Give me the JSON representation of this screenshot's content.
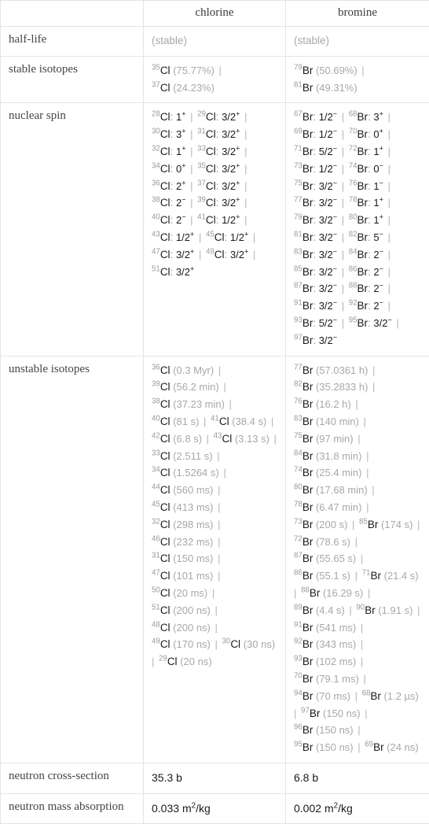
{
  "table": {
    "columns": [
      "",
      "chlorine",
      "bromine"
    ],
    "rows": [
      {
        "label": "half-life",
        "type": "dim",
        "chlorine": "(stable)",
        "bromine": "(stable)"
      },
      {
        "label": "stable isotopes",
        "type": "isotopes",
        "chlorine": [
          {
            "mass": "35",
            "el": "Cl",
            "note": "(75.77%)"
          },
          {
            "mass": "37",
            "el": "Cl",
            "note": "(24.23%)"
          }
        ],
        "bromine": [
          {
            "mass": "79",
            "el": "Br",
            "note": "(50.69%)"
          },
          {
            "mass": "81",
            "el": "Br",
            "note": "(49.31%)"
          }
        ]
      },
      {
        "label": "nuclear spin",
        "type": "spin",
        "chlorine": [
          {
            "mass": "28",
            "el": "Cl",
            "spin": "1",
            "charge": "+"
          },
          {
            "mass": "29",
            "el": "Cl",
            "spin": "3/2",
            "charge": "+"
          },
          {
            "mass": "30",
            "el": "Cl",
            "spin": "3",
            "charge": "+"
          },
          {
            "mass": "31",
            "el": "Cl",
            "spin": "3/2",
            "charge": "+"
          },
          {
            "mass": "32",
            "el": "Cl",
            "spin": "1",
            "charge": "+"
          },
          {
            "mass": "33",
            "el": "Cl",
            "spin": "3/2",
            "charge": "+"
          },
          {
            "mass": "34",
            "el": "Cl",
            "spin": "0",
            "charge": "+"
          },
          {
            "mass": "35",
            "el": "Cl",
            "spin": "3/2",
            "charge": "+"
          },
          {
            "mass": "36",
            "el": "Cl",
            "spin": "2",
            "charge": "+"
          },
          {
            "mass": "37",
            "el": "Cl",
            "spin": "3/2",
            "charge": "+"
          },
          {
            "mass": "38",
            "el": "Cl",
            "spin": "2",
            "charge": "−"
          },
          {
            "mass": "39",
            "el": "Cl",
            "spin": "3/2",
            "charge": "+"
          },
          {
            "mass": "40",
            "el": "Cl",
            "spin": "2",
            "charge": "−"
          },
          {
            "mass": "41",
            "el": "Cl",
            "spin": "1/2",
            "charge": "+"
          },
          {
            "mass": "43",
            "el": "Cl",
            "spin": "1/2",
            "charge": "+"
          },
          {
            "mass": "45",
            "el": "Cl",
            "spin": "1/2",
            "charge": "+"
          },
          {
            "mass": "47",
            "el": "Cl",
            "spin": "3/2",
            "charge": "+"
          },
          {
            "mass": "49",
            "el": "Cl",
            "spin": "3/2",
            "charge": "+"
          },
          {
            "mass": "51",
            "el": "Cl",
            "spin": "3/2",
            "charge": "+"
          }
        ],
        "bromine": [
          {
            "mass": "67",
            "el": "Br",
            "spin": "1/2",
            "charge": "−"
          },
          {
            "mass": "68",
            "el": "Br",
            "spin": "3",
            "charge": "+"
          },
          {
            "mass": "69",
            "el": "Br",
            "spin": "1/2",
            "charge": "−"
          },
          {
            "mass": "70",
            "el": "Br",
            "spin": "0",
            "charge": "+"
          },
          {
            "mass": "71",
            "el": "Br",
            "spin": "5/2",
            "charge": "−"
          },
          {
            "mass": "72",
            "el": "Br",
            "spin": "1",
            "charge": "+"
          },
          {
            "mass": "73",
            "el": "Br",
            "spin": "1/2",
            "charge": "−"
          },
          {
            "mass": "74",
            "el": "Br",
            "spin": "0",
            "charge": "−"
          },
          {
            "mass": "75",
            "el": "Br",
            "spin": "3/2",
            "charge": "−"
          },
          {
            "mass": "76",
            "el": "Br",
            "spin": "1",
            "charge": "−"
          },
          {
            "mass": "77",
            "el": "Br",
            "spin": "3/2",
            "charge": "−"
          },
          {
            "mass": "78",
            "el": "Br",
            "spin": "1",
            "charge": "+"
          },
          {
            "mass": "79",
            "el": "Br",
            "spin": "3/2",
            "charge": "−"
          },
          {
            "mass": "80",
            "el": "Br",
            "spin": "1",
            "charge": "+"
          },
          {
            "mass": "81",
            "el": "Br",
            "spin": "3/2",
            "charge": "−"
          },
          {
            "mass": "82",
            "el": "Br",
            "spin": "5",
            "charge": "−"
          },
          {
            "mass": "83",
            "el": "Br",
            "spin": "3/2",
            "charge": "−"
          },
          {
            "mass": "84",
            "el": "Br",
            "spin": "2",
            "charge": "−"
          },
          {
            "mass": "85",
            "el": "Br",
            "spin": "3/2",
            "charge": "−"
          },
          {
            "mass": "86",
            "el": "Br",
            "spin": "2",
            "charge": "−"
          },
          {
            "mass": "87",
            "el": "Br",
            "spin": "3/2",
            "charge": "−"
          },
          {
            "mass": "88",
            "el": "Br",
            "spin": "2",
            "charge": "−"
          },
          {
            "mass": "91",
            "el": "Br",
            "spin": "3/2",
            "charge": "−"
          },
          {
            "mass": "92",
            "el": "Br",
            "spin": "2",
            "charge": "−"
          },
          {
            "mass": "93",
            "el": "Br",
            "spin": "5/2",
            "charge": "−"
          },
          {
            "mass": "95",
            "el": "Br",
            "spin": "3/2",
            "charge": "−"
          },
          {
            "mass": "97",
            "el": "Br",
            "spin": "3/2",
            "charge": "−"
          }
        ]
      },
      {
        "label": "unstable isotopes",
        "type": "isotopes",
        "chlorine": [
          {
            "mass": "36",
            "el": "Cl",
            "note": "(0.3 Myr)"
          },
          {
            "mass": "39",
            "el": "Cl",
            "note": "(56.2 min)"
          },
          {
            "mass": "38",
            "el": "Cl",
            "note": "(37.23 min)"
          },
          {
            "mass": "40",
            "el": "Cl",
            "note": "(81 s)"
          },
          {
            "mass": "41",
            "el": "Cl",
            "note": "(38.4 s)"
          },
          {
            "mass": "42",
            "el": "Cl",
            "note": "(6.8 s)"
          },
          {
            "mass": "43",
            "el": "Cl",
            "note": "(3.13 s)"
          },
          {
            "mass": "33",
            "el": "Cl",
            "note": "(2.511 s)"
          },
          {
            "mass": "34",
            "el": "Cl",
            "note": "(1.5264 s)"
          },
          {
            "mass": "44",
            "el": "Cl",
            "note": "(560 ms)"
          },
          {
            "mass": "45",
            "el": "Cl",
            "note": "(413 ms)"
          },
          {
            "mass": "32",
            "el": "Cl",
            "note": "(298 ms)"
          },
          {
            "mass": "46",
            "el": "Cl",
            "note": "(232 ms)"
          },
          {
            "mass": "31",
            "el": "Cl",
            "note": "(150 ms)"
          },
          {
            "mass": "47",
            "el": "Cl",
            "note": "(101 ms)"
          },
          {
            "mass": "50",
            "el": "Cl",
            "note": "(20 ms)"
          },
          {
            "mass": "51",
            "el": "Cl",
            "note": "(200 ns)"
          },
          {
            "mass": "48",
            "el": "Cl",
            "note": "(200 ns)"
          },
          {
            "mass": "49",
            "el": "Cl",
            "note": "(170 ns)"
          },
          {
            "mass": "30",
            "el": "Cl",
            "note": "(30 ns)"
          },
          {
            "mass": "29",
            "el": "Cl",
            "note": "(20 ns)"
          }
        ],
        "bromine": [
          {
            "mass": "77",
            "el": "Br",
            "note": "(57.0361 h)"
          },
          {
            "mass": "82",
            "el": "Br",
            "note": "(35.2833 h)"
          },
          {
            "mass": "76",
            "el": "Br",
            "note": "(16.2 h)"
          },
          {
            "mass": "83",
            "el": "Br",
            "note": "(140 min)"
          },
          {
            "mass": "75",
            "el": "Br",
            "note": "(97 min)"
          },
          {
            "mass": "84",
            "el": "Br",
            "note": "(31.8 min)"
          },
          {
            "mass": "74",
            "el": "Br",
            "note": "(25.4 min)"
          },
          {
            "mass": "80",
            "el": "Br",
            "note": "(17.68 min)"
          },
          {
            "mass": "78",
            "el": "Br",
            "note": "(6.47 min)"
          },
          {
            "mass": "73",
            "el": "Br",
            "note": "(200 s)"
          },
          {
            "mass": "85",
            "el": "Br",
            "note": "(174 s)"
          },
          {
            "mass": "72",
            "el": "Br",
            "note": "(78.6 s)"
          },
          {
            "mass": "87",
            "el": "Br",
            "note": "(55.65 s)"
          },
          {
            "mass": "86",
            "el": "Br",
            "note": "(55.1 s)"
          },
          {
            "mass": "71",
            "el": "Br",
            "note": "(21.4 s)"
          },
          {
            "mass": "88",
            "el": "Br",
            "note": "(16.29 s)"
          },
          {
            "mass": "89",
            "el": "Br",
            "note": "(4.4 s)"
          },
          {
            "mass": "90",
            "el": "Br",
            "note": "(1.91 s)"
          },
          {
            "mass": "91",
            "el": "Br",
            "note": "(541 ms)"
          },
          {
            "mass": "92",
            "el": "Br",
            "note": "(343 ms)"
          },
          {
            "mass": "93",
            "el": "Br",
            "note": "(102 ms)"
          },
          {
            "mass": "70",
            "el": "Br",
            "note": "(79.1 ms)"
          },
          {
            "mass": "94",
            "el": "Br",
            "note": "(70 ms)"
          },
          {
            "mass": "68",
            "el": "Br",
            "note": "(1.2 µs)"
          },
          {
            "mass": "97",
            "el": "Br",
            "note": "(150 ns)"
          },
          {
            "mass": "96",
            "el": "Br",
            "note": "(150 ns)"
          },
          {
            "mass": "95",
            "el": "Br",
            "note": "(150 ns)"
          },
          {
            "mass": "69",
            "el": "Br",
            "note": "(24 ns)"
          }
        ]
      },
      {
        "label": "neutron cross-section",
        "type": "plain",
        "chlorine": "35.3 b",
        "bromine": "6.8 b"
      },
      {
        "label": "neutron mass absorption",
        "type": "unit",
        "chlorine": {
          "number": "0.033",
          "unit": "m",
          "exp": "2",
          "per": "/kg"
        },
        "bromine": {
          "number": "0.002",
          "unit": "m",
          "exp": "2",
          "per": "/kg"
        }
      }
    ]
  },
  "colors": {
    "border": "#e4e4e4",
    "text": "#3c3c3c",
    "value": "#1a1a1a",
    "dim": "#a8a8a8",
    "nuclide": "#9a9a9a"
  }
}
